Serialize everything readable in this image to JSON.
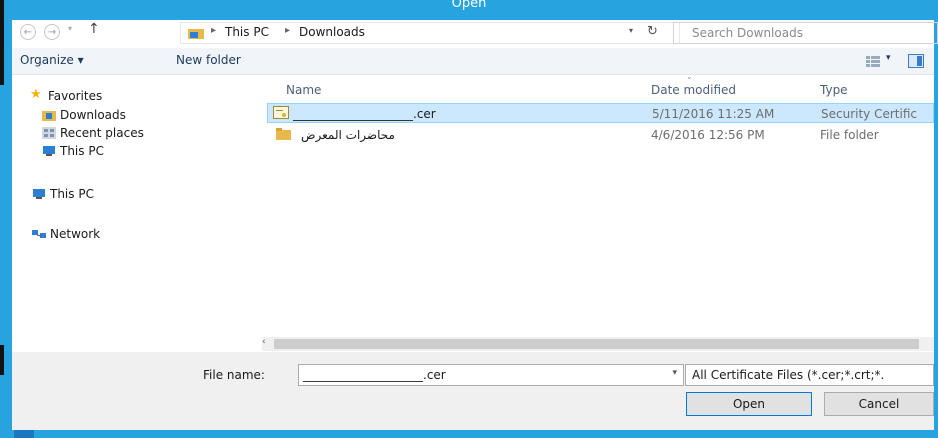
{
  "window": {
    "title": "Open"
  },
  "nav": {
    "back_glyph": "←",
    "forward_glyph": "→",
    "up_glyph": "↑",
    "breadcrumb": [
      "This PC",
      "Downloads"
    ],
    "refresh_glyph": "↻",
    "search_placeholder": "Search Downloads"
  },
  "toolbar": {
    "organize_label": "Organize ▾",
    "new_folder_label": "New folder"
  },
  "sidebar": {
    "items": [
      {
        "label": "Favorites",
        "icon": "star-icon"
      },
      {
        "label": "Downloads",
        "icon": "downloads-folder-icon"
      },
      {
        "label": "Recent places",
        "icon": "recent-places-icon"
      },
      {
        "label": "This PC",
        "icon": "computer-icon"
      },
      {
        "label": "This PC",
        "icon": "computer-icon"
      },
      {
        "label": "Network",
        "icon": "network-icon"
      }
    ]
  },
  "files": {
    "columns": [
      "Name",
      "Date modified",
      "Type"
    ],
    "rows": [
      {
        "name": "____________________.cer",
        "date": "5/11/2016 11:25 AM",
        "type": "Security Certific",
        "icon": "certificate-icon"
      },
      {
        "name": "محاضرات المعرض",
        "date": "4/6/2016 12:56 PM",
        "type": "File folder",
        "icon": "folder-icon"
      }
    ]
  },
  "bottom": {
    "file_name_label": "File name:",
    "file_name_value": "____________________.cer",
    "filter_value": "All Certificate Files (*.cer;*.crt;*.",
    "open_label": "Open",
    "cancel_label": "Cancel"
  },
  "colors": {
    "frame": "#27a4df",
    "selection": "#cce8ff",
    "toolbar": "#f1f4f9"
  }
}
